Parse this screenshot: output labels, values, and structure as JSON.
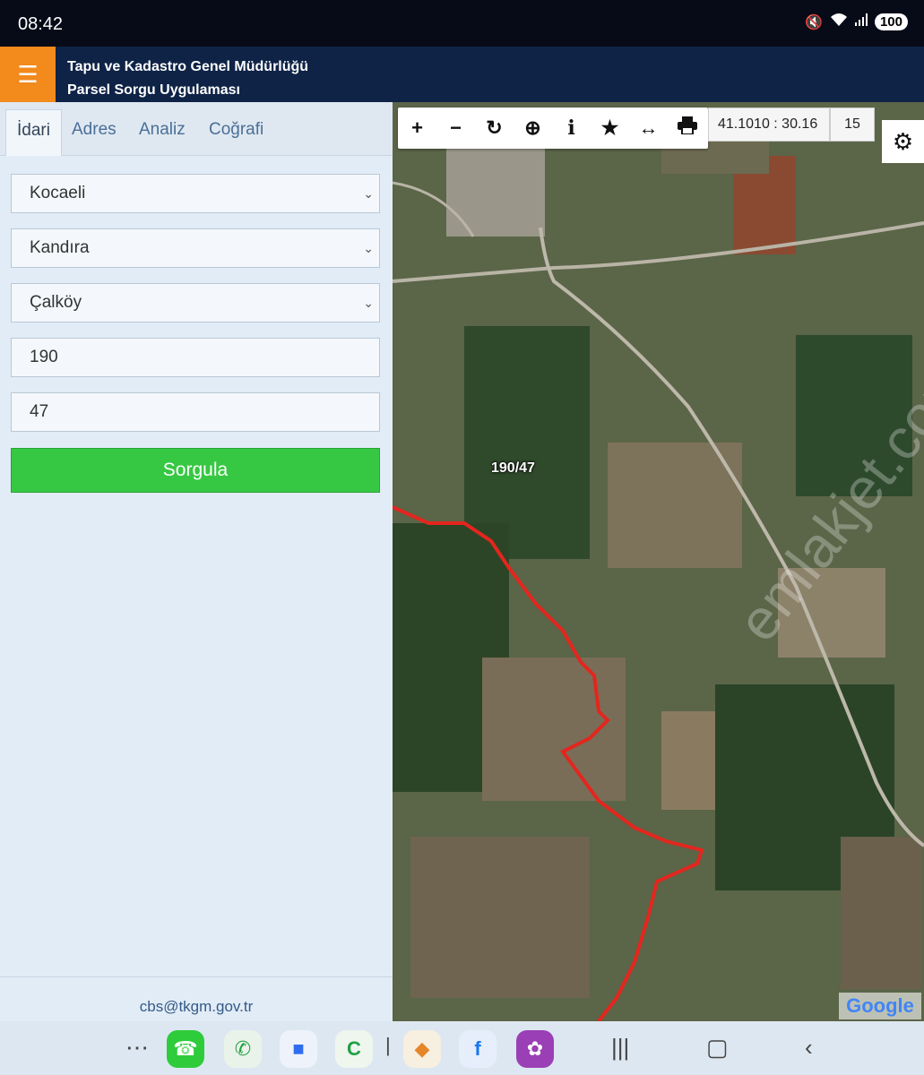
{
  "status": {
    "time": "08:42",
    "battery": "100"
  },
  "header": {
    "title_line1": "Tapu ve Kadastro Genel Müdürlüğü",
    "title_line2": "Parsel Sorgu Uygulaması"
  },
  "tabs": [
    {
      "label": "İdari"
    },
    {
      "label": "Adres"
    },
    {
      "label": "Analiz"
    },
    {
      "label": "Coğrafi"
    }
  ],
  "form": {
    "province": "Kocaeli",
    "district": "Kandıra",
    "neighborhood": "Çalköy",
    "block": "190",
    "parcel": "47",
    "query_label": "Sorgula"
  },
  "footer": {
    "email": "cbs@tkgm.gov.tr"
  },
  "map": {
    "coordinates": "41.1010 : 30.16",
    "zoom": "15",
    "parcel_label": "190/47",
    "google": "Google",
    "watermark": "emlakjet.com",
    "boundary_color": "#e3261e"
  },
  "toolbar_icons": [
    "plus-icon",
    "minus-icon",
    "refresh-icon",
    "locate-icon",
    "info-icon",
    "star-icon",
    "measure-icon",
    "print-icon"
  ]
}
